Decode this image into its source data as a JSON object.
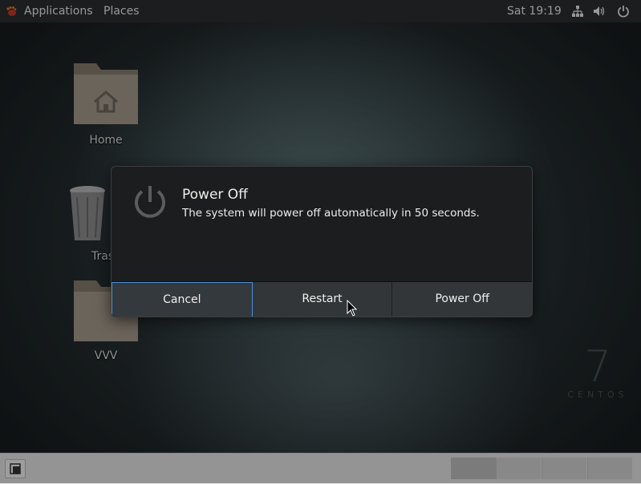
{
  "topbar": {
    "applications": "Applications",
    "places": "Places",
    "clock": "Sat 19:19"
  },
  "desktop": {
    "icons": [
      {
        "label": "Home"
      },
      {
        "label": "Tras"
      },
      {
        "label": "VVV"
      }
    ],
    "branding": {
      "number": "7",
      "word": "CENTOS"
    }
  },
  "dialog": {
    "title": "Power Off",
    "message": "The system will power off automatically in 50 seconds.",
    "buttons": {
      "cancel": "Cancel",
      "restart": "Restart",
      "power_off": "Power Off"
    }
  },
  "colors": {
    "focus_border": "#4a90d9",
    "dialog_bg": "#1b1d1f",
    "button_bg": "#333639"
  }
}
